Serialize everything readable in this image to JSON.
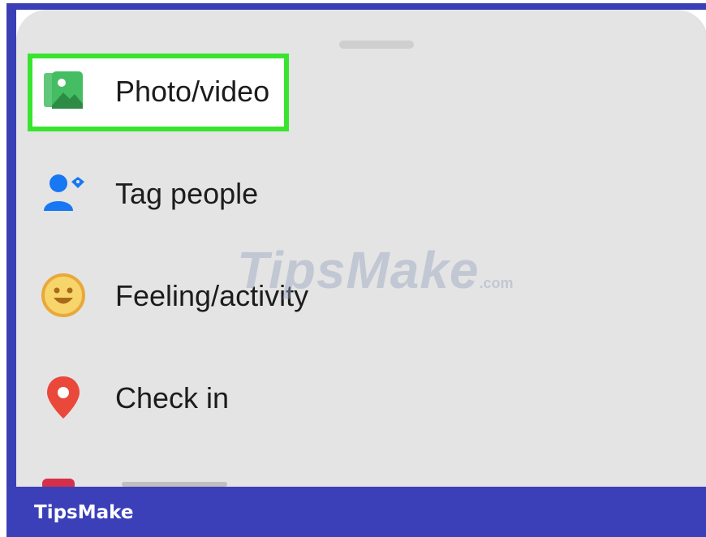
{
  "menu": {
    "items": [
      {
        "label": "Photo/video",
        "icon": "photo-video-icon",
        "color": "#45bd62"
      },
      {
        "label": "Tag people",
        "icon": "tag-people-icon",
        "color": "#1877f2"
      },
      {
        "label": "Feeling/activity",
        "icon": "smiley-icon",
        "color": "#f7b928"
      },
      {
        "label": "Check in",
        "icon": "location-pin-icon",
        "color": "#e9483a"
      }
    ]
  },
  "watermark": {
    "main": "TipsMake",
    "suffix": ".com"
  },
  "footer": {
    "brand": "TipsMake"
  },
  "colors": {
    "highlight": "#39e42f",
    "frame": "#3b3fb5",
    "sheet": "#e4e4e4"
  }
}
